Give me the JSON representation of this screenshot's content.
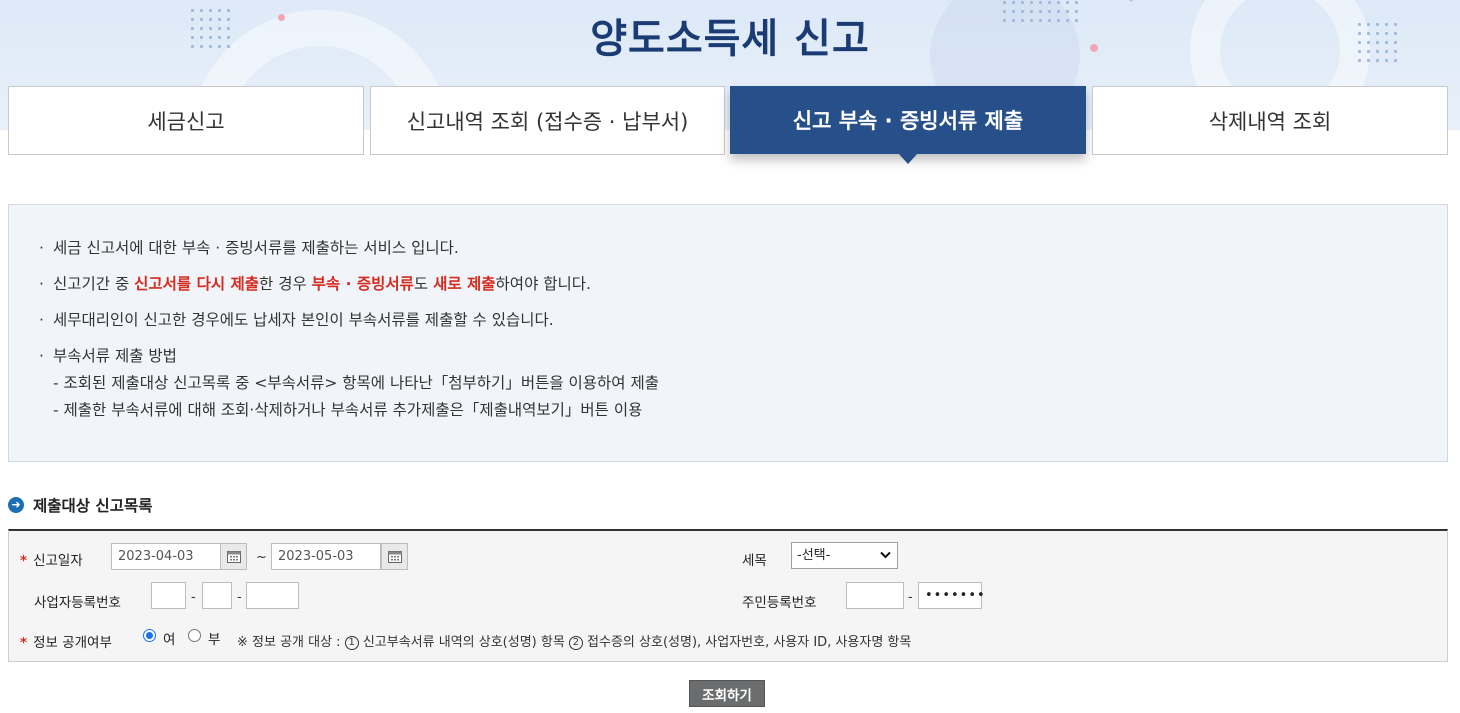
{
  "header": {
    "title": "양도소득세 신고"
  },
  "tabs": [
    {
      "label": "세금신고"
    },
    {
      "label": "신고내역 조회 (접수증 · 납부서)"
    },
    {
      "label": "신고 부속 · 증빙서류 제출"
    },
    {
      "label": "삭제내역 조회"
    }
  ],
  "active_tab": "신고 부속 · 증빙서류 제출",
  "info": {
    "bullet": "·",
    "line1": "세금 신고서에 대한 부속 · 증빙서류를 제출하는 서비스 입니다.",
    "line2_a": "신고기간 중 ",
    "line2_b": "신고서를 다시 제출",
    "line2_c": "한 경우 ",
    "line2_d": "부속 · 증빙서류",
    "line2_e": "도 ",
    "line2_f": "새로 제출",
    "line2_g": "하여야 합니다.",
    "line3": "세무대리인이 신고한 경우에도 납세자 본인이 부속서류를 제출할 수 있습니다.",
    "line4": "부속서류 제출 방법",
    "sub1": "- 조회된 제출대상 신고목록 중 <부속서류> 항목에 나타난「첨부하기」버튼을 이용하여 제출",
    "sub2": "- 제출한 부속서류에 대해 조회·삭제하거나 부속서류 추가제출은「제출내역보기」버튼 이용"
  },
  "section": {
    "title": "제출대상 신고목록"
  },
  "form": {
    "required_mark": "*",
    "date_label": "신고일자",
    "date_from": "2023-04-03",
    "date_sep": "~",
    "date_to": "2023-05-03",
    "tax_label": "세목",
    "tax_selected": "-선택-",
    "bizno_label": "사업자등록번호",
    "bizno_parts": [
      "",
      "",
      ""
    ],
    "dash": "-",
    "resno_label": "주민등록번호",
    "resno_front": "",
    "resno_back": "•••••••",
    "disclose_label": "정보 공개여부",
    "disclose_yes": "여",
    "disclose_no": "부",
    "disclose_selected": "여",
    "note_a": "※ 정보 공개 대상 : ",
    "note_n1": "1",
    "note_b": " 신고부속서류 내역의 상호(성명) 항목 ",
    "note_n2": "2",
    "note_c": " 접수증의 상호(성명), 사업자번호, 사용자 ID, 사용자명 항목"
  },
  "buttons": {
    "search": "조회하기"
  },
  "colors": {
    "tab_active": "#27508a",
    "title": "#1b3b74",
    "highlight": "#d62b1f",
    "search_button": "#6a6c6e"
  }
}
